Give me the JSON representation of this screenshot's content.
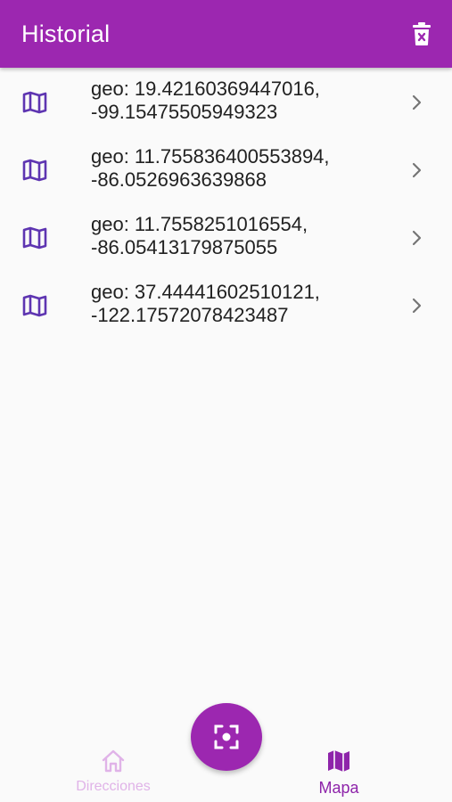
{
  "app_bar": {
    "title": "Historial",
    "action_icon": "delete-icon",
    "color": "#9c27b0"
  },
  "history": {
    "items": [
      {
        "icon": "map-icon",
        "line1": "geo: 19.42160369447016,",
        "line2": "-99.15475505949323"
      },
      {
        "icon": "map-icon",
        "line1": "geo: 11.755836400553894,",
        "line2": "-86.0526963639868"
      },
      {
        "icon": "map-icon",
        "line1": "geo: 11.7558251016554,",
        "line2": "-86.05413179875055"
      },
      {
        "icon": "map-icon",
        "line1": "geo: 37.44441602510121,",
        "line2": "-122.17572078423487"
      }
    ]
  },
  "bottom_nav": {
    "items": [
      {
        "label": "Direcciones",
        "icon": "home-icon",
        "selected": false
      },
      {
        "label": "Mapa",
        "icon": "map-icon",
        "selected": true
      }
    ],
    "fab_icon": "scan-icon"
  },
  "colors": {
    "accent": "#9c27b0",
    "icon": "#5e35b1",
    "selected": "#8e24aa",
    "unselected": "#e0b3e8",
    "chevron": "#757575"
  }
}
